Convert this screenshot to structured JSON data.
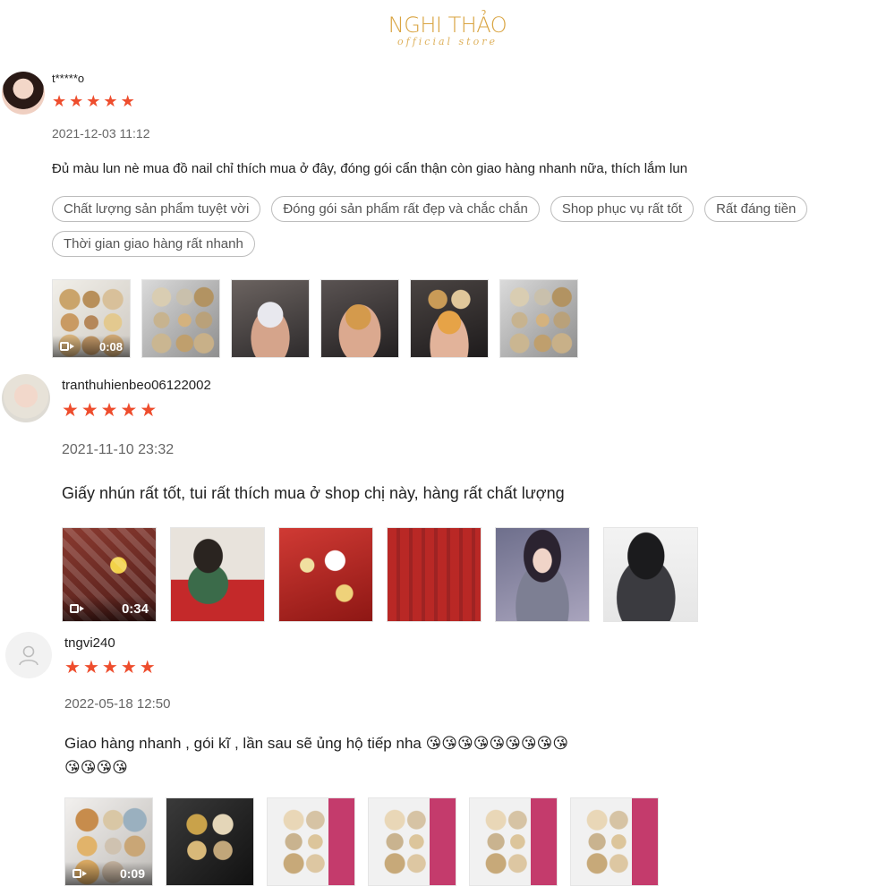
{
  "brand": {
    "title": "NGHI THẢO",
    "subtitle": "official store"
  },
  "reviews": [
    {
      "username": "t*****o",
      "stars": 5,
      "date": "2021-12-03 11:12",
      "comment": "Đủ màu lun nè mua đồ nail chỉ thích mua ở đây, đóng gói cẩn thận còn giao hàng nhanh nữa,  thích lắm lun",
      "tags": [
        "Chất lượng sản phẩm tuyệt vời",
        "Đóng gói sản phẩm rất đẹp và chắc chắn",
        "Shop phục vụ rất tốt",
        "Rất đáng tiền",
        "Thời gian giao hàng rất nhanh"
      ],
      "video_duration": "0:08"
    },
    {
      "username": "tranthuhienbeo06122002",
      "stars": 5,
      "date": "2021-11-10 23:32",
      "comment": "Giấy nhún rất tốt, tui rất thích mua ở shop chị này, hàng rất chất lượng",
      "video_duration": "0:34"
    },
    {
      "username": "tngvi240",
      "stars": 5,
      "date": "2022-05-18 12:50",
      "comment_line1": "Giao hàng nhanh , gói kĩ , lần sau sẽ ủng hộ tiếp nha 😘😘😘😘😘😘😘😘😘",
      "comment_line2": "😘😘😘😘",
      "video_duration": "0:09"
    }
  ],
  "icons": {
    "star": "star-icon",
    "video": "video-camera-icon",
    "user": "user-placeholder-icon"
  },
  "colors": {
    "brand": "#d9a441",
    "star": "#ee4d2d"
  }
}
